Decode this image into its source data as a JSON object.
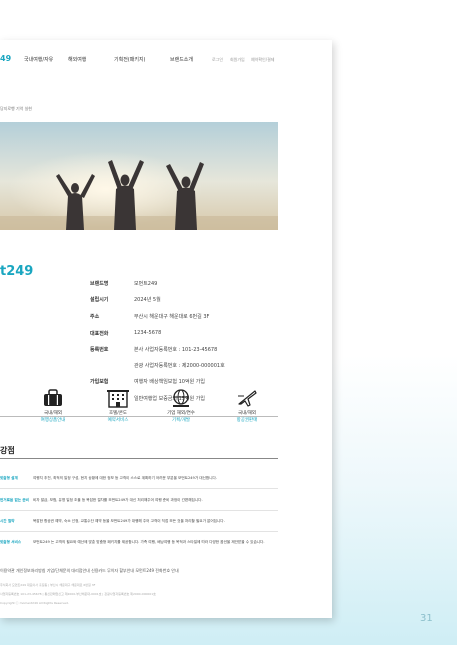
{
  "nav": {
    "logo": "49",
    "menu": [
      "국내여행/자유",
      "해외여행",
      "기획전(패키지)",
      "브랜드소개"
    ],
    "util": [
      "로그인",
      "회원가입",
      "예약확인/결제"
    ]
  },
  "breadcrumb": "당지로행 기억 실현",
  "brand_name": "t249",
  "info": [
    {
      "label": "브랜드명",
      "values": [
        "모먼트249"
      ]
    },
    {
      "label": "설립시기",
      "values": [
        "2024년 5월"
      ]
    },
    {
      "label": "주소",
      "values": [
        "부산시 해운대구 해운대로 6번길 3F"
      ]
    },
    {
      "label": "대표전화",
      "values": [
        "1234-5678"
      ]
    },
    {
      "label": "등록번호",
      "values": [
        "본사 사업자등록번호 : 101-23-45678",
        "관광 사업자등록번호 : 제2000-000001호"
      ]
    },
    {
      "label": "가입보험",
      "values": [
        "여행자 배상책임보험 10억원 가입",
        "일반여행업 보증금의 15억원 가입"
      ]
    }
  ],
  "services": [
    {
      "icon": "luggage-icon",
      "line1": "국내/해외",
      "line2": "여행상품안내"
    },
    {
      "icon": "hotel-icon",
      "line1": "호텔/콘도",
      "line2": "예약서비스"
    },
    {
      "icon": "globe-icon",
      "line1": "기업 해외/연수",
      "line2": "기획/개발"
    },
    {
      "icon": "airplane-icon",
      "line1": "국내/해외",
      "line2": "항공권판매"
    }
  ],
  "strengths_title": "강점",
  "strengths": [
    {
      "key": "맞춤형 설계",
      "text": "여행지 추천, 최적의 일정 구성, 현지 상황에 대한 정보 등 고객이 스스로 계획하기 어려운 부분을 모먼트249가 대신합니다."
    },
    {
      "key": "번거로움 없는 준비",
      "text": "비자 발급, 보험, 유명 일정 조율 등 복잡한 절차를 모먼트249가 대신 처리해주어 여행 준비 과정이 간편해집니다."
    },
    {
      "key": "시간 절약",
      "text": "복잡한 항공권 예약, 숙소 선정, 교통수단 예약 등을 모먼트249가 대행해 주어 고객이 직접 모든 것을 처리할 필요가 없어집니다."
    },
    {
      "key": "맞춤형 서비스",
      "text": "모먼트249 는 고객의 필요와 예산에 맞춘 맞춤형 패키지를 제공합니다. 가족 여행, 배낭여행 등 목적과 스타일에 따라 다양한 옵션을 제안받을 수 있습니다."
    }
  ],
  "footer": {
    "main": "이용약관 개인정보처리방침 기업/단체문의 대리점안내 신용카드 무이자 할부안내 모먼트249 전화번호 안내",
    "lines": [
      "주식회사 모먼트249 대표이사 홍길동 | 부산시 해운대구 해운대로 6번길 3F",
      "사업자등록번호 101-23-45678 | 통신판매업신고 제2000-부산해운대-0001호 | 관광사업자등록번호 제2000-000001호",
      "Copyright ⓒ moment249 All Rights Reserved."
    ]
  },
  "page_number": "31",
  "colors": {
    "accent": "#1aa6c0"
  }
}
